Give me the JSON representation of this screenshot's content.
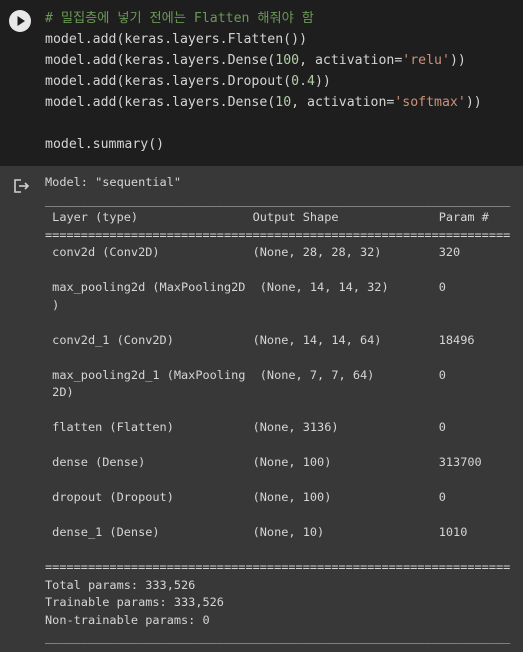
{
  "code_cell": {
    "lines": [
      {
        "parts": [
          {
            "t": "# 밀집층에 넣기 전에는 Flatten 해줘야 함",
            "c": "cm"
          }
        ]
      },
      {
        "parts": [
          {
            "t": "model.add(keras.layers.Flatten())",
            "c": ""
          }
        ]
      },
      {
        "parts": [
          {
            "t": "model.add(keras.layers.Dense(",
            "c": ""
          },
          {
            "t": "100",
            "c": "num"
          },
          {
            "t": ", activation=",
            "c": ""
          },
          {
            "t": "'relu'",
            "c": "str"
          },
          {
            "t": "))",
            "c": ""
          }
        ]
      },
      {
        "parts": [
          {
            "t": "model.add(keras.layers.Dropout(",
            "c": ""
          },
          {
            "t": "0.4",
            "c": "num"
          },
          {
            "t": "))",
            "c": ""
          }
        ]
      },
      {
        "parts": [
          {
            "t": "model.add(keras.layers.Dense(",
            "c": ""
          },
          {
            "t": "10",
            "c": "num"
          },
          {
            "t": ", activation=",
            "c": ""
          },
          {
            "t": "'softmax'",
            "c": "str"
          },
          {
            "t": "))",
            "c": ""
          }
        ]
      },
      {
        "parts": [
          {
            "t": "",
            "c": ""
          }
        ]
      },
      {
        "parts": [
          {
            "t": "model.summary()",
            "c": ""
          }
        ]
      }
    ]
  },
  "output": {
    "lines": [
      "Model: \"sequential\"",
      "_________________________________________________________________",
      " Layer (type)                Output Shape              Param #   ",
      "=================================================================",
      " conv2d (Conv2D)             (None, 28, 28, 32)        320       ",
      "                                                                 ",
      " max_pooling2d (MaxPooling2D  (None, 14, 14, 32)       0         ",
      " )                                                               ",
      "                                                                 ",
      " conv2d_1 (Conv2D)           (None, 14, 14, 64)        18496     ",
      "                                                                 ",
      " max_pooling2d_1 (MaxPooling  (None, 7, 7, 64)         0         ",
      " 2D)                                                             ",
      "                                                                 ",
      " flatten (Flatten)           (None, 3136)              0         ",
      "                                                                 ",
      " dense (Dense)               (None, 100)               313700    ",
      "                                                                 ",
      " dropout (Dropout)           (None, 100)               0         ",
      "                                                                 ",
      " dense_1 (Dense)             (None, 10)                1010      ",
      "                                                                 ",
      "=================================================================",
      "Total params: 333,526",
      "Trainable params: 333,526",
      "Non-trainable params: 0",
      "_________________________________________________________________"
    ]
  },
  "icons": {
    "run": "play-icon",
    "output": "output-arrow-icon"
  },
  "colors": {
    "comment": "#6a9955",
    "number": "#b5cea8",
    "string": "#ce9178"
  }
}
